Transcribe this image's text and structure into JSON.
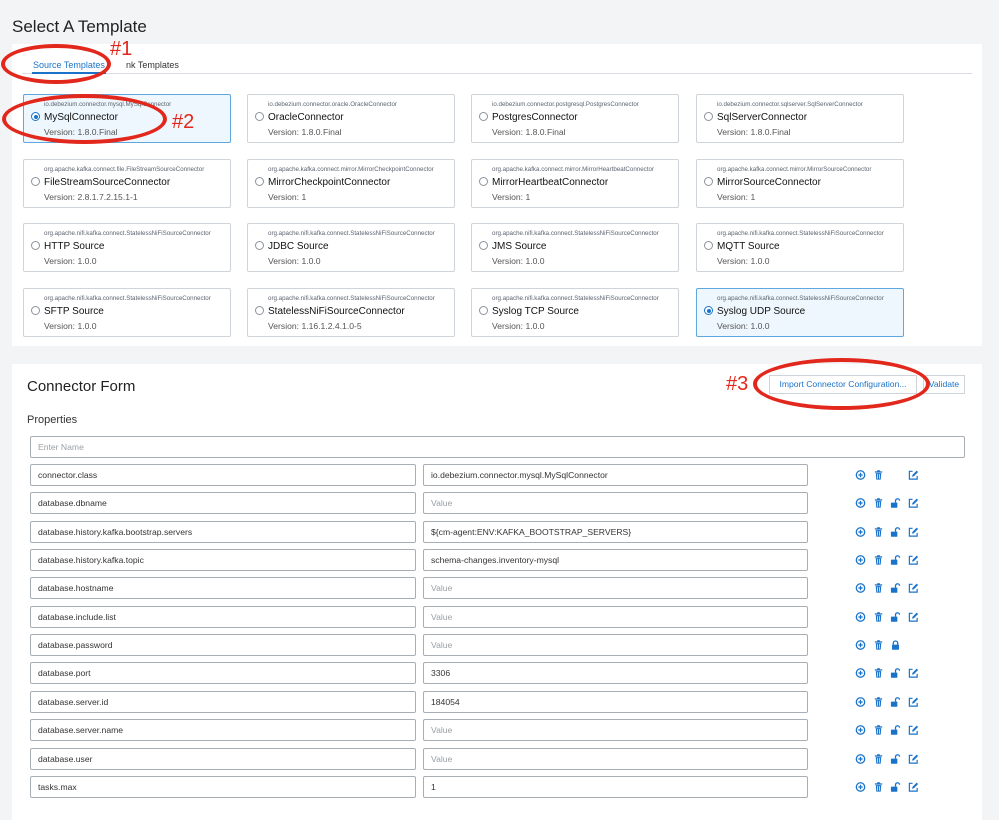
{
  "page": {
    "title": "Select A Template"
  },
  "tabs": [
    {
      "label": "Source Templates",
      "active": true
    },
    {
      "label": "nk Templates",
      "active": false
    }
  ],
  "templates": [
    {
      "class": "io.debezium.connector.mysql.MySqlConnector",
      "name": "MySqlConnector",
      "version": "Version: 1.8.0.Final",
      "selected": true
    },
    {
      "class": "io.debezium.connector.oracle.OracleConnector",
      "name": "OracleConnector",
      "version": "Version: 1.8.0.Final"
    },
    {
      "class": "io.debezium.connector.postgresql.PostgresConnector",
      "name": "PostgresConnector",
      "version": "Version: 1.8.0.Final"
    },
    {
      "class": "io.debezium.connector.sqlserver.SqlServerConnector",
      "name": "SqlServerConnector",
      "version": "Version: 1.8.0.Final"
    },
    {
      "class": "org.apache.kafka.connect.file.FileStreamSourceConnector",
      "name": "FileStreamSourceConnector",
      "version": "Version: 2.8.1.7.2.15.1-1"
    },
    {
      "class": "org.apache.kafka.connect.mirror.MirrorCheckpointConnector",
      "name": "MirrorCheckpointConnector",
      "version": "Version: 1"
    },
    {
      "class": "org.apache.kafka.connect.mirror.MirrorHeartbeatConnector",
      "name": "MirrorHeartbeatConnector",
      "version": "Version: 1"
    },
    {
      "class": "org.apache.kafka.connect.mirror.MirrorSourceConnector",
      "name": "MirrorSourceConnector",
      "version": "Version: 1"
    },
    {
      "class": "org.apache.nifi.kafka.connect.StatelessNiFiSourceConnector",
      "name": "HTTP Source",
      "version": "Version: 1.0.0"
    },
    {
      "class": "org.apache.nifi.kafka.connect.StatelessNiFiSourceConnector",
      "name": "JDBC Source",
      "version": "Version: 1.0.0"
    },
    {
      "class": "org.apache.nifi.kafka.connect.StatelessNiFiSourceConnector",
      "name": "JMS Source",
      "version": "Version: 1.0.0"
    },
    {
      "class": "org.apache.nifi.kafka.connect.StatelessNiFiSourceConnector",
      "name": "MQTT Source",
      "version": "Version: 1.0.0"
    },
    {
      "class": "org.apache.nifi.kafka.connect.StatelessNiFiSourceConnector",
      "name": "SFTP Source",
      "version": "Version: 1.0.0"
    },
    {
      "class": "org.apache.nifi.kafka.connect.StatelessNiFiSourceConnector",
      "name": "StatelessNiFiSourceConnector",
      "version": "Version: 1.16.1.2.4.1.0-5"
    },
    {
      "class": "org.apache.nifi.kafka.connect.StatelessNiFiSourceConnector",
      "name": "Syslog TCP Source",
      "version": "Version: 1.0.0"
    },
    {
      "class": "org.apache.nifi.kafka.connect.StatelessNiFiSourceConnector",
      "name": "Syslog UDP Source",
      "version": "Version: 1.0.0",
      "highlighted": true
    }
  ],
  "form": {
    "title": "Connector Form",
    "import_label": "Import Connector Configuration...",
    "validate_label": "Validate",
    "properties_title": "Properties",
    "name_placeholder": "Enter Name",
    "value_placeholder": "Value"
  },
  "properties": [
    {
      "key": "connector.class",
      "value": "io.debezium.connector.mysql.MySqlConnector",
      "lock": "none",
      "edit": true
    },
    {
      "key": "database.dbname",
      "value": "",
      "lock": "open",
      "edit": true
    },
    {
      "key": "database.history.kafka.bootstrap.servers",
      "value": "${cm-agent:ENV:KAFKA_BOOTSTRAP_SERVERS}",
      "lock": "open",
      "edit": true
    },
    {
      "key": "database.history.kafka.topic",
      "value": "schema-changes.inventory-mysql",
      "lock": "open",
      "edit": true
    },
    {
      "key": "database.hostname",
      "value": "",
      "lock": "open",
      "edit": true
    },
    {
      "key": "database.include.list",
      "value": "",
      "lock": "open",
      "edit": true
    },
    {
      "key": "database.password",
      "value": "",
      "lock": "closed",
      "edit": false
    },
    {
      "key": "database.port",
      "value": "3306",
      "lock": "open",
      "edit": true
    },
    {
      "key": "database.server.id",
      "value": "184054",
      "lock": "open",
      "edit": true
    },
    {
      "key": "database.server.name",
      "value": "",
      "lock": "open",
      "edit": true
    },
    {
      "key": "database.user",
      "value": "",
      "lock": "open",
      "edit": true
    },
    {
      "key": "tasks.max",
      "value": "1",
      "lock": "open",
      "edit": true
    }
  ],
  "annotations": [
    {
      "label": "#1"
    },
    {
      "label": "#2"
    },
    {
      "label": "#3"
    }
  ],
  "colors": {
    "accent": "#1a73c9",
    "annotation": "#e2271c",
    "selected_bg": "#eef7fd"
  }
}
